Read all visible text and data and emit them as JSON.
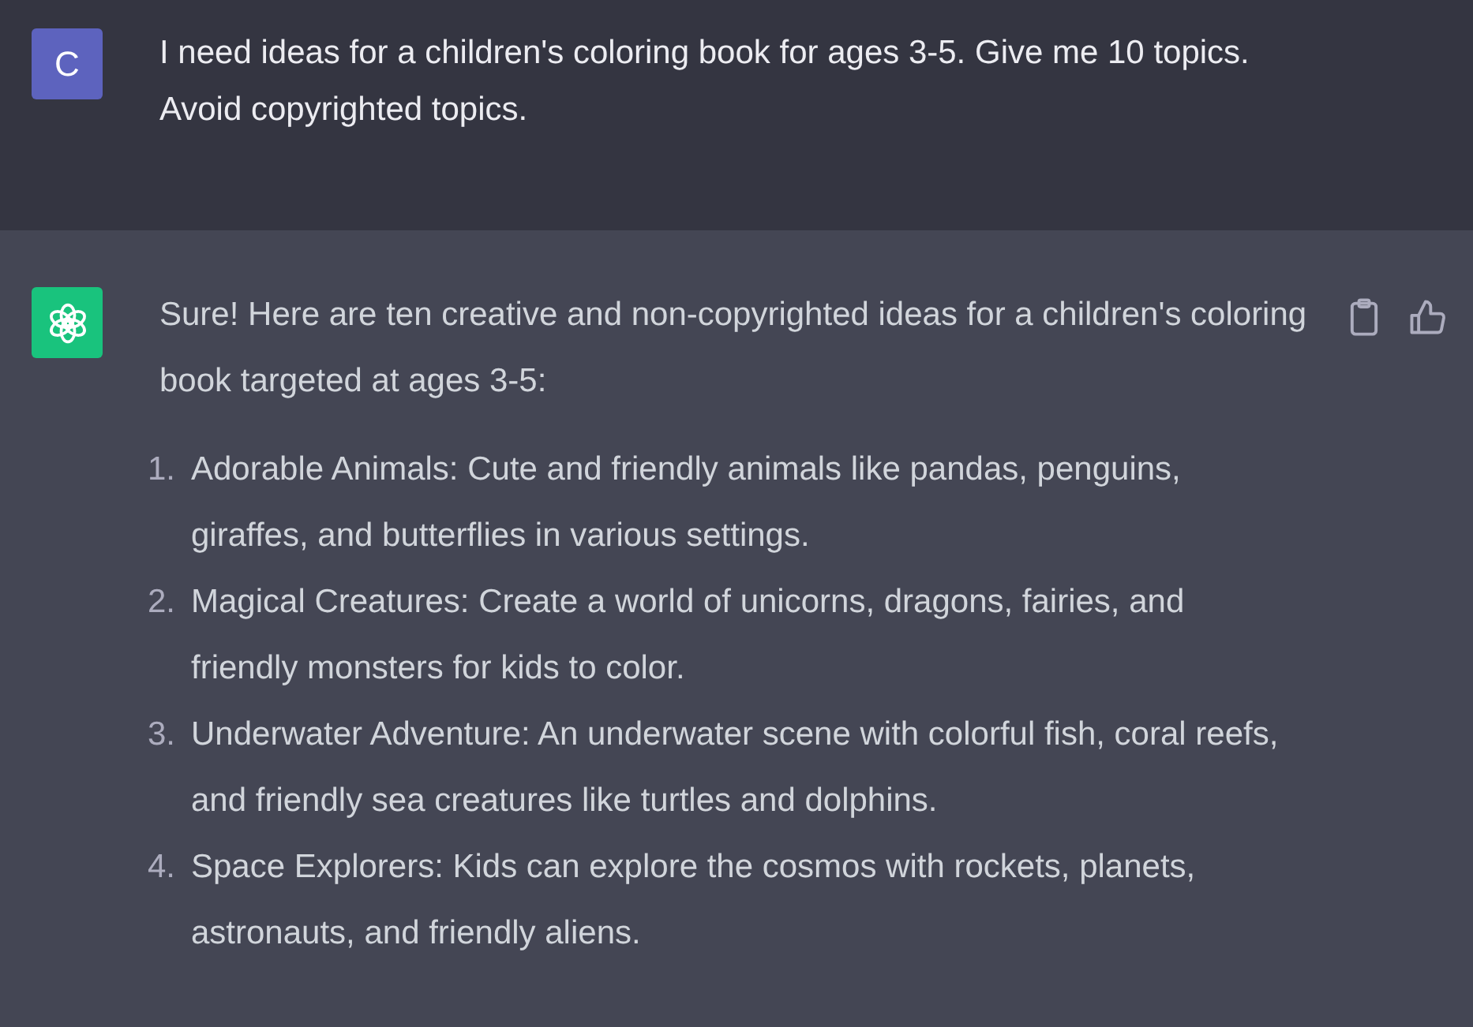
{
  "messages": [
    {
      "kind": "user",
      "avatar": "C",
      "text": "I need ideas for a children's coloring book for ages 3-5. Give me 10 topics. Avoid copyrighted topics."
    },
    {
      "kind": "assistant",
      "text": "Sure! Here are ten creative and non-copyrighted ideas for a children's coloring book targeted at ages 3-5:",
      "list": [
        {
          "number": "1.",
          "text": "Adorable Animals: Cute and friendly animals like pandas, penguins, giraffes, and butterflies in various settings."
        },
        {
          "number": "2.",
          "text": "Magical Creatures: Create a world of unicorns, dragons, fairies, and friendly monsters for kids to color."
        },
        {
          "number": "3.",
          "text": "Underwater Adventure: An underwater scene with colorful fish, coral reefs, and friendly sea creatures like turtles and dolphins."
        },
        {
          "number": "4.",
          "text": "Space Explorers: Kids can explore the cosmos with rockets, planets, astronauts, and friendly aliens."
        }
      ]
    }
  ]
}
